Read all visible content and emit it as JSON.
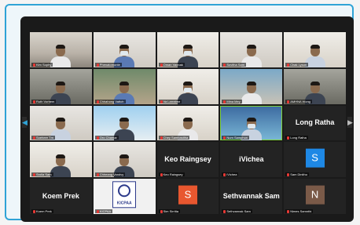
{
  "meeting": {
    "nav_left_icon": "chevron-left-icon",
    "nav_right_icon": "chevron-right-icon",
    "nav_left_glyph": "◀",
    "nav_right_glyph": "▶"
  },
  "tiles": [
    {
      "label": "Kim Sophy",
      "kind": "video"
    },
    {
      "label": "Phenatomonte",
      "kind": "video"
    },
    {
      "label": "Oman Vannak",
      "kind": "video"
    },
    {
      "label": "Sovitha Sam",
      "kind": "video"
    },
    {
      "label": "Chak Lyson",
      "kind": "video"
    },
    {
      "label": "Ruth Vorbem",
      "kind": "video"
    },
    {
      "label": "Chhahong Vattoh",
      "kind": "video"
    },
    {
      "label": "Va Larrabee",
      "kind": "video"
    },
    {
      "label": "Mina Mey",
      "kind": "video"
    },
    {
      "label": "AMHNA Wong",
      "kind": "video"
    },
    {
      "label": "Soeheer Tm",
      "kind": "video"
    },
    {
      "label": "Oro Chamar",
      "kind": "video"
    },
    {
      "label": "Chey Sambasitha",
      "kind": "video"
    },
    {
      "label": "Num Samphun",
      "kind": "video"
    },
    {
      "label": "Long Ratha",
      "kind": "name",
      "big": "Long Ratha"
    },
    {
      "label": "Srolla Sam",
      "kind": "video"
    },
    {
      "label": "Chheang Vandvy",
      "kind": "video"
    },
    {
      "label": "Keo Raingsey",
      "kind": "name",
      "big": "Keo Raingsey"
    },
    {
      "label": "iVichea",
      "kind": "name",
      "big": "iVichea"
    },
    {
      "label": "Sam Dinitho",
      "kind": "avatar",
      "letter": "S"
    },
    {
      "label": "Koem Prek",
      "kind": "name",
      "big": "Koem Prek"
    },
    {
      "label": "KICPAA",
      "kind": "logo",
      "logo_text": "KICPAA"
    },
    {
      "label": "Sim Sirrlita",
      "kind": "avatar",
      "letter": "S"
    },
    {
      "label": "Sethvannak Sam",
      "kind": "name",
      "big": "Sethvannak Sam"
    },
    {
      "label": "Nimes Samnthi",
      "kind": "avatar",
      "letter": "N"
    }
  ]
}
